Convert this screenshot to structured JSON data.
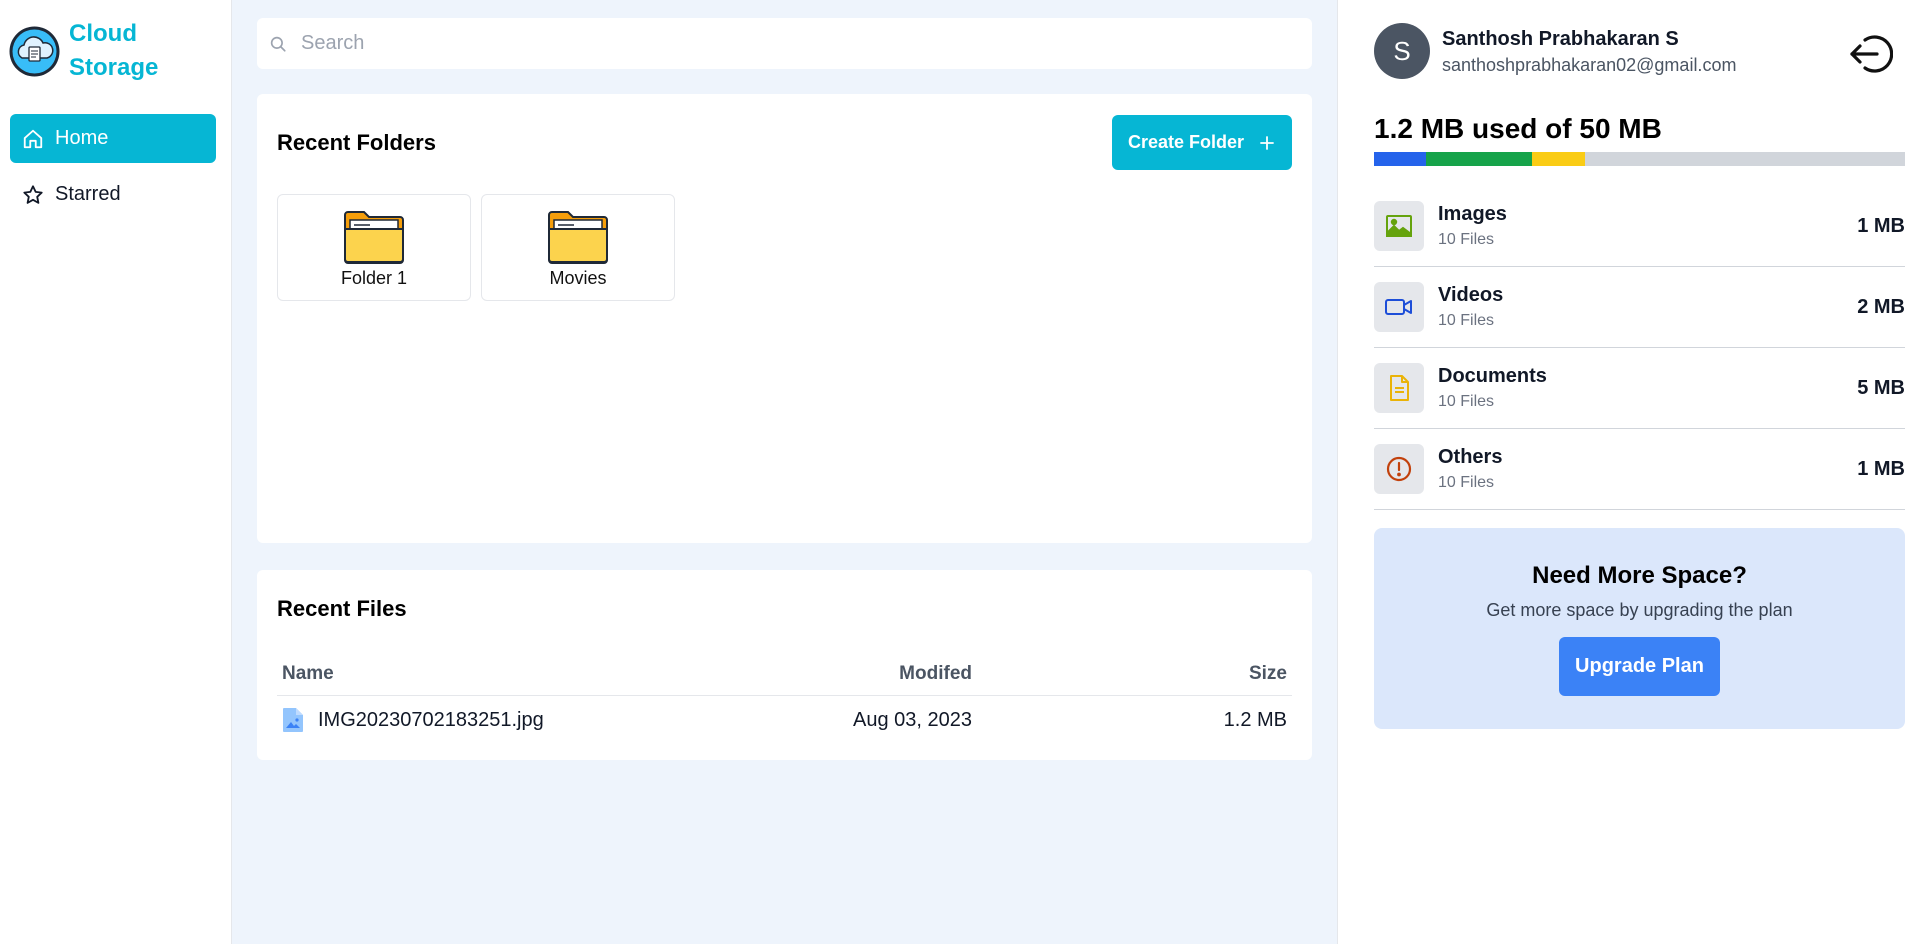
{
  "app": {
    "brand_name": "Cloud Storage"
  },
  "sidebar": {
    "items": [
      {
        "label": "Home",
        "icon": "home-icon",
        "active": true
      },
      {
        "label": "Starred",
        "icon": "star-icon",
        "active": false
      }
    ]
  },
  "search": {
    "placeholder": "Search",
    "value": ""
  },
  "recent_folders": {
    "title": "Recent Folders",
    "create_label": "Create Folder",
    "folders": [
      {
        "name": "Folder 1"
      },
      {
        "name": "Movies"
      }
    ]
  },
  "recent_files": {
    "title": "Recent Files",
    "columns": [
      "Name",
      "Modifed",
      "Size"
    ],
    "rows": [
      {
        "name": "IMG20230702183251.jpg",
        "modified": "Aug 03, 2023",
        "size": "1.2 MB"
      }
    ]
  },
  "user": {
    "initial": "S",
    "name": "Santhosh Prabhakaran S",
    "email": "santhoshprabhakaran02@gmail.com"
  },
  "storage": {
    "summary": "1.2 MB used of 50 MB",
    "segments": [
      {
        "fraction": 0.0977,
        "color": "#2563eb"
      },
      {
        "fraction": 0.2,
        "color": "#16a34a"
      },
      {
        "fraction": 0.1,
        "color": "#facc15"
      }
    ],
    "categories": [
      {
        "name": "Images",
        "count": "10 Files",
        "size": "1 MB",
        "icon": "image-icon",
        "color": "#65a30d"
      },
      {
        "name": "Videos",
        "count": "10 Files",
        "size": "2 MB",
        "icon": "video-icon",
        "color": "#1d4ed8"
      },
      {
        "name": "Documents",
        "count": "10 Files",
        "size": "5 MB",
        "icon": "document-icon",
        "color": "#eab308"
      },
      {
        "name": "Others",
        "count": "10 Files",
        "size": "1 MB",
        "icon": "alert-circle-icon",
        "color": "#c2410c"
      }
    ]
  },
  "promo": {
    "title": "Need More Space?",
    "subtitle": "Get more space by upgrading the plan",
    "button_label": "Upgrade Plan"
  }
}
